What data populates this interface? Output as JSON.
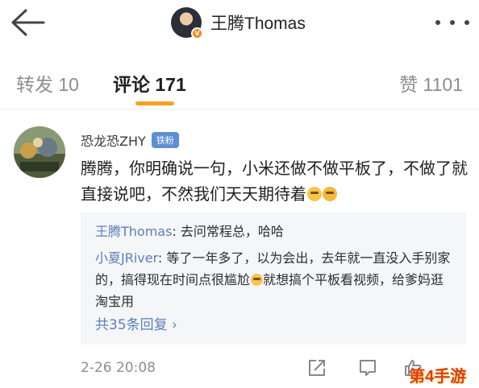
{
  "header": {
    "back_icon": "arrow-left-icon",
    "username": "王腾Thomas",
    "verified_icon": "verified-v-badge-icon",
    "more_icon": "ellipsis-horizontal-icon"
  },
  "tabs": [
    {
      "label": "转发 10",
      "active": false
    },
    {
      "label": "评论 171",
      "active": true
    },
    {
      "label": "赞 1101",
      "active": false
    }
  ],
  "colors": {
    "accent": "#f7a021",
    "link_blue": "#5b80b7",
    "badge_blue": "#5e8fd1",
    "watermark_red": "#e23d0c"
  },
  "comment": {
    "author": "恐龙恐ZHY",
    "badge": "铁粉",
    "text": "腾腾，你明确说一句，小米还做不做平板了，不做了就直接说吧，不然我们天天期待着",
    "emojis": [
      "laugh-cry-emoji",
      "cry-emoji"
    ],
    "timestamp": "2-26 20:08"
  },
  "replies": [
    {
      "author": "王腾Thomas",
      "separator": ": ",
      "text": "去问常程总，哈哈"
    },
    {
      "author": "小夏JRiver",
      "separator": ": ",
      "text_before": "等了一年多了，以为会出，去年就一直没入手别家的，搞得现在时间点很尴尬",
      "emoji": "laugh-cry-emoji",
      "text_after": "就想搞个平板看视频，给爹妈逛淘宝用"
    }
  ],
  "more_replies": "共35条回复 ›",
  "actions": {
    "share_icon": "share-icon",
    "comment_icon": "comment-icon",
    "like_icon": "thumbs-up-icon"
  },
  "watermark": "第4手游"
}
